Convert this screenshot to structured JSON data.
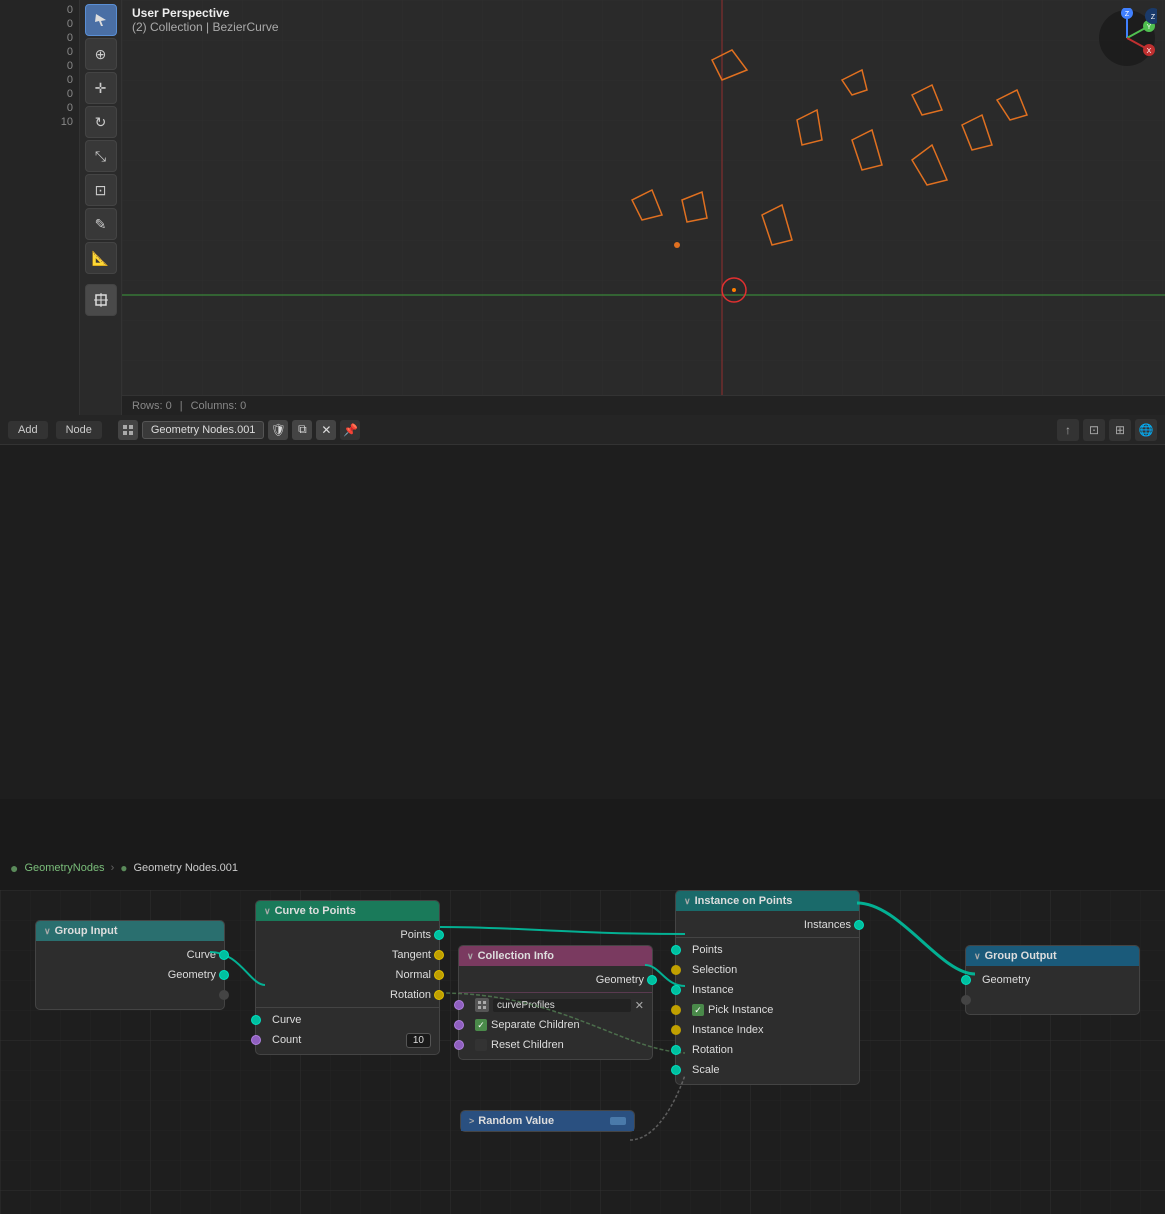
{
  "viewport": {
    "title": "User Perspective",
    "subtitle": "(2) Collection | BezierCurve",
    "status": {
      "rows_label": "Rows:",
      "rows_value": "0",
      "separator": "|",
      "columns_label": "Columns:",
      "columns_value": "0"
    }
  },
  "node_editor": {
    "header": {
      "menu": [
        "Add",
        "Node"
      ],
      "node_name": "Geometry Nodes.001",
      "right_icons": [
        "upload-icon",
        "overlay-icon",
        "viewport-icon",
        "world-icon"
      ]
    },
    "breadcrumb": {
      "items": [
        "GeometryNodes",
        ">",
        "Geometry Nodes.001"
      ]
    },
    "nodes": {
      "group_input": {
        "title": "Group Input",
        "collapse_arrow": "∨",
        "outputs": [
          {
            "label": "Curve",
            "socket": "cyan"
          },
          {
            "label": "Geometry",
            "socket": "cyan"
          }
        ],
        "footer_socket": true
      },
      "curve_to_points": {
        "title": "Curve to Points",
        "collapse_arrow": "∨",
        "inputs": [
          {
            "label": "Points",
            "socket": "cyan"
          },
          {
            "label": "Tangent",
            "socket": "yellow"
          },
          {
            "label": "Normal",
            "socket": "yellow"
          },
          {
            "label": "Rotation",
            "socket": "yellow"
          }
        ],
        "params": [
          {
            "label": "Curve",
            "socket_in": "cyan"
          },
          {
            "label": "Count",
            "value": "10",
            "socket_in": "purple"
          }
        ]
      },
      "collection_info": {
        "title": "Collection Info",
        "collapse_arrow": "∨",
        "outputs": [
          {
            "label": "Geometry",
            "socket": "cyan"
          }
        ],
        "params": [
          {
            "icon": "cube",
            "label": "curveProfiles",
            "has_x": true
          },
          {
            "checkbox": true,
            "label": "Separate Children"
          },
          {
            "checkbox": false,
            "label": "Reset Children"
          }
        ]
      },
      "instance_on_points": {
        "title": "Instance on Points",
        "collapse_arrow": "∨",
        "outputs": [
          {
            "label": "Instances",
            "socket": "cyan"
          }
        ],
        "inputs": [
          {
            "label": "Points",
            "socket": "cyan"
          },
          {
            "label": "Selection",
            "socket": "diamond_yellow"
          },
          {
            "label": "Instance",
            "socket": "cyan"
          },
          {
            "label": "Pick Instance",
            "socket": "diamond_yellow",
            "checkbox": true
          },
          {
            "label": "Instance Index",
            "socket": "diamond_yellow"
          },
          {
            "label": "Rotation",
            "socket": "cyan"
          },
          {
            "label": "Scale",
            "socket": "cyan"
          }
        ]
      },
      "group_output": {
        "title": "Group Output",
        "collapse_arrow": "∨",
        "inputs": [
          {
            "label": "Geometry",
            "socket": "cyan"
          }
        ],
        "footer_socket": true
      },
      "random_value": {
        "title": "Random Value",
        "collapse_arrow": ">",
        "collapsed": true
      }
    }
  },
  "left_numbers": [
    "0",
    "0",
    "0",
    "0",
    "0",
    "0",
    "0",
    "0",
    "10"
  ],
  "axis_labels": {
    "z": "Z",
    "y": "Y",
    "x": "X"
  }
}
